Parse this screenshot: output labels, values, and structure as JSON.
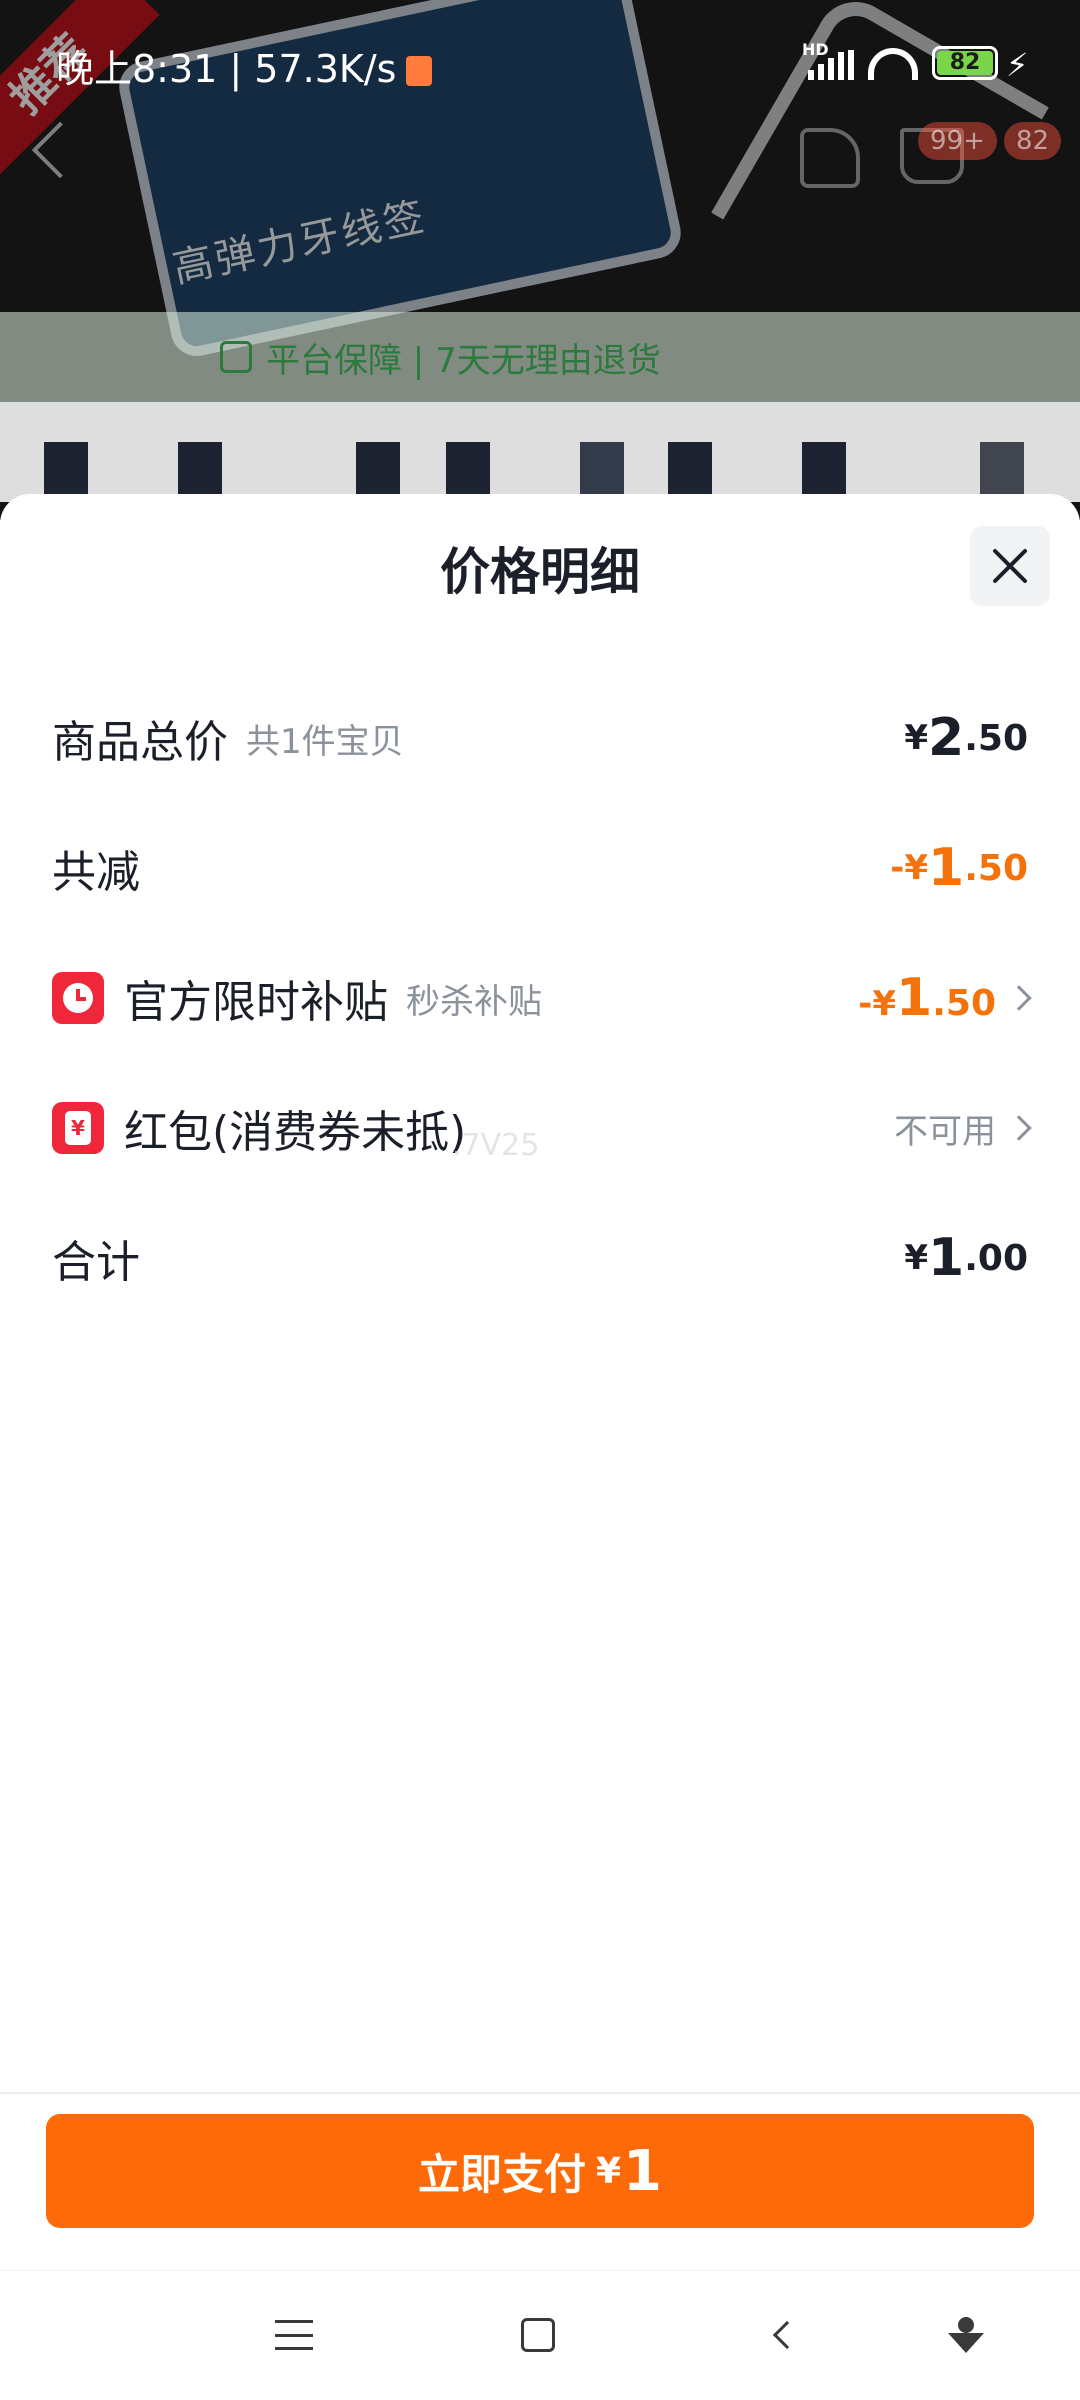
{
  "status_bar": {
    "time": "晚上8:31 | 57.3K/s",
    "network_label": "HD",
    "battery": "82"
  },
  "background": {
    "ribbon_text": "推荐",
    "product_text": "高弹力牙线签",
    "cart_badge": "99+",
    "message_badge": "82",
    "guarantee_text": "平台保障 | 7天无理由退货"
  },
  "sheet": {
    "title": "价格明细",
    "rows": [
      {
        "label": "商品总价",
        "sub": "共1件宝贝",
        "currency": "¥",
        "int": "2",
        "dec": ".50"
      },
      {
        "label": "共减",
        "sign": "-",
        "currency": "¥",
        "int": "1",
        "dec": ".50"
      },
      {
        "label": "官方限时补贴",
        "sub": "秒杀补贴",
        "sign": "-",
        "currency": "¥",
        "int": "1",
        "dec": ".50"
      },
      {
        "label": "红包(消费券未抵)",
        "status": "不可用"
      },
      {
        "label": "合计",
        "currency": "¥",
        "int": "1",
        "dec": ".00"
      }
    ],
    "hongbao_glyph": "¥",
    "watermark": ".7V25"
  },
  "pay": {
    "label": "立即支付",
    "currency": "¥",
    "amount": "1"
  },
  "colors": {
    "accent": "#ff6a08",
    "discount": "#f4720a",
    "icon_red": "#f0263b"
  }
}
